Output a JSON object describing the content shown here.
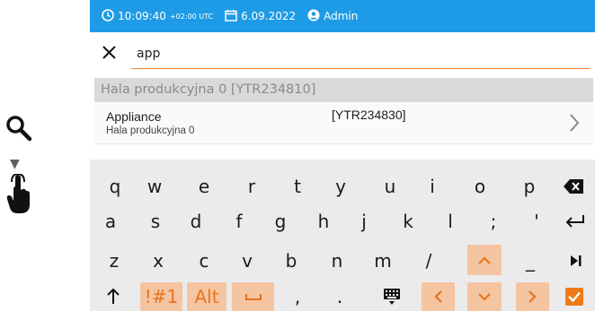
{
  "left_panel": {
    "icons": [
      "search-icon",
      "arrow-down-icon",
      "touch-hand-icon"
    ]
  },
  "status_bar": {
    "time": "10:09:40",
    "timezone": "+02:00 UTC",
    "date": "6.09.2022",
    "user": "Admin",
    "background_color": "#1e9be6"
  },
  "search": {
    "value": "app",
    "underline_color": "#f08030"
  },
  "results": {
    "section_header": "Hala produkcyjna 0 [YTR234810]",
    "items": [
      {
        "title": "Appliance",
        "subtitle": "Hala produkcyjna 0",
        "code": "[YTR234830]"
      }
    ]
  },
  "keyboard": {
    "row1": [
      "q",
      "w",
      "e",
      "r",
      "t",
      "y",
      "u",
      "i",
      "o",
      "p"
    ],
    "row2": [
      "a",
      "s",
      "d",
      "f",
      "g",
      "h",
      "j",
      "k",
      "l",
      ";",
      "'"
    ],
    "row3": [
      "z",
      "x",
      "c",
      "v",
      "b",
      "n",
      "m",
      "/",
      "_"
    ],
    "symbols_label": "!#1",
    "alt_label": "Alt",
    "row4_extra": [
      ",",
      "."
    ],
    "accent_color": "#f07a1a"
  }
}
